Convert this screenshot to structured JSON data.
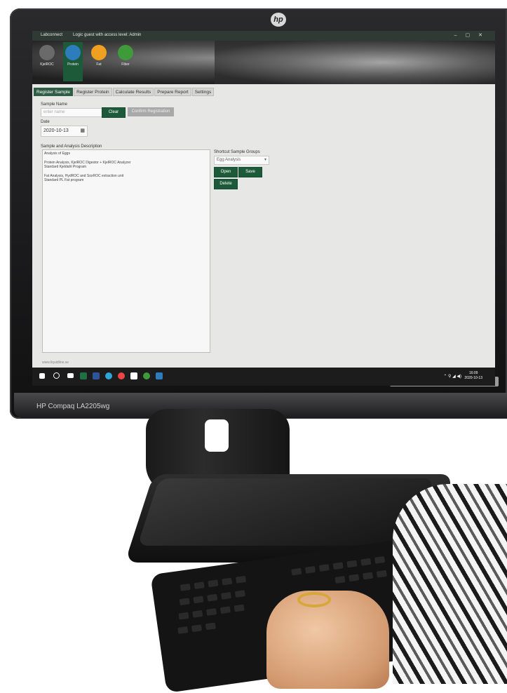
{
  "monitor": {
    "brand_logo_text": "hp",
    "model_label": "HP Compaq LA2205wg"
  },
  "window": {
    "app_name": "Labconnect",
    "login_status": "Logic guest with access level: Admin"
  },
  "app_icons": [
    {
      "label": "KjelROC",
      "color": "#5a5a5a"
    },
    {
      "label": "Protein",
      "color": "#2d7dbd"
    },
    {
      "label": "Fat",
      "color": "#f0a020"
    },
    {
      "label": "Fiber",
      "color": "#3f9a3a"
    }
  ],
  "tabs": [
    {
      "label": "Register Sample",
      "active": true
    },
    {
      "label": "Register Protein",
      "active": false
    },
    {
      "label": "Calculate Results",
      "active": false
    },
    {
      "label": "Prepare Report",
      "active": false
    },
    {
      "label": "Settings",
      "active": false
    }
  ],
  "form": {
    "sample_name_label": "Sample Name",
    "sample_name_placeholder": "enter name",
    "clear_button": "Clear",
    "confirm_button": "Confirm Registration",
    "date_label": "Date",
    "date_value": "2020-10-13",
    "description_label": "Sample and Analysis Description",
    "description_lines": [
      "Analysis of Eggs",
      "",
      "Protein Analysis, KjelROC Digestor + KjelROC Analyzer",
      "Standard Kjeldahl Program",
      "",
      "Fat Analysis, HydROC and SoxROC extraction unit",
      "Standard PL Fat program"
    ]
  },
  "shortcut": {
    "label": "Shortcut Sample Groups",
    "selected": "Egg Analysis",
    "open_button": "Open",
    "save_button": "Save",
    "delete_button": "Delete"
  },
  "footer_url": "www.liquidline.se",
  "taskbar": {
    "time": "16:09",
    "date": "2020-10-13"
  },
  "colors": {
    "accent_green": "#1d5a3a",
    "window_bg": "#e7e7e5"
  }
}
